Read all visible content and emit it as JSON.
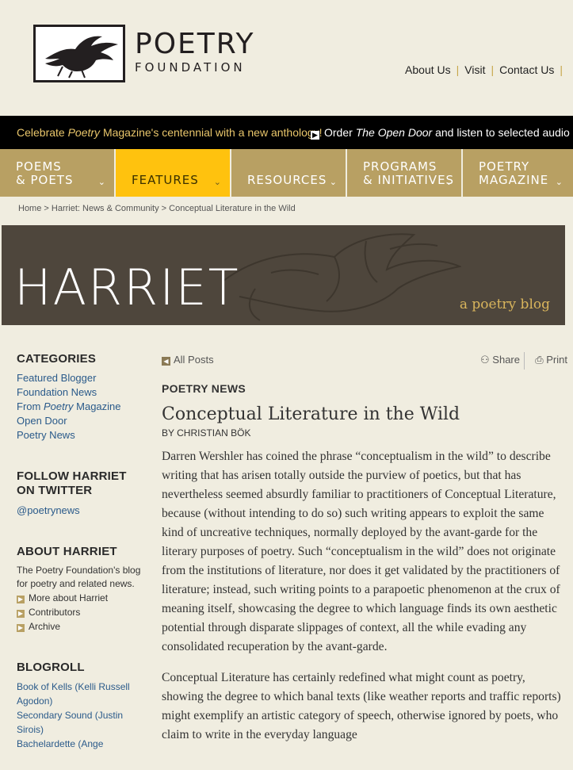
{
  "header": {
    "logo_line1": "POETRY",
    "logo_line2": "FOUNDATION",
    "links": [
      "About Us",
      "Visit",
      "Contact Us"
    ]
  },
  "banner": {
    "part1_pre": "Celebrate ",
    "part1_em": "Poetry",
    "part1_post": " Magazine's centennial with a new anthology!",
    "part2_pre": "Order ",
    "part2_em": "The Open Door",
    "part2_post": " and listen to selected audio poems"
  },
  "nav": [
    {
      "label": "POEMS\n& POETS",
      "active": false
    },
    {
      "label": "FEATURES",
      "active": true
    },
    {
      "label": "RESOURCES",
      "active": false
    },
    {
      "label": "PROGRAMS\n& INITIATIVES",
      "active": false
    },
    {
      "label": "POETRY\nMAGAZINE",
      "active": false
    }
  ],
  "breadcrumb": [
    "Home",
    "Harriet: News & Community",
    "Conceptual Literature in the Wild"
  ],
  "hero": {
    "title": "HARRIET",
    "subtitle": "a poetry blog"
  },
  "sidebar": {
    "categories_heading": "CATEGORIES",
    "categories": [
      "Featured Blogger",
      "Foundation News",
      "From Poetry Magazine",
      "Open Door",
      "Poetry News"
    ],
    "follow_heading": "FOLLOW HARRIET ON TWITTER",
    "twitter_handle": "@poetrynews",
    "about_heading": "ABOUT HARRIET",
    "about_text": "The Poetry Foundation's blog for poetry and related news.",
    "about_links": [
      "More about Harriet",
      "Contributors",
      "Archive"
    ],
    "blogroll_heading": "BLOGROLL",
    "blogroll": [
      "Book of Kells (Kelli Russell Agodon)",
      "Secondary Sound (Justin Sirois)",
      "Bachelardette (Ange"
    ]
  },
  "post": {
    "all_posts": "All Posts",
    "share": "Share",
    "print": "Print",
    "category": "POETRY NEWS",
    "title": "Conceptual Literature in the Wild",
    "by_prefix": "BY ",
    "author": "CHRISTIAN BÖK",
    "paragraphs": [
      "Darren Wershler has coined the phrase “conceptualism in the wild” to describe writing that has arisen totally outside the purview of poetics, but that has nevertheless seemed absurdly familiar to practitioners of Conceptual Literature, because (without intending to do so) such writing appears to exploit the same kind of uncreative techniques, normally deployed by the avant-garde for the literary purposes of poetry. Such “conceptualism in the wild” does not originate from the institutions of literature, nor does it get validated by the practitioners of literature; instead, such writing points to a parapoetic phenomenon at the crux of meaning itself, showcasing the degree to which language finds its own aesthetic potential through disparate slippages of context, all the while evading any consolidated recuperation by the avant-garde.",
      "Conceptual Literature has certainly redefined what might count as poetry, showing the degree to which banal texts (like weather reports and traffic reports) might exemplify an artistic category of speech, otherwise ignored by poets, who claim to write in the everyday language"
    ]
  },
  "colors": {
    "background": "#f0ede0",
    "nav": "#b8a063",
    "nav_active": "#ffc20e",
    "hero": "#4e463c",
    "link": "#2a5a8a"
  }
}
